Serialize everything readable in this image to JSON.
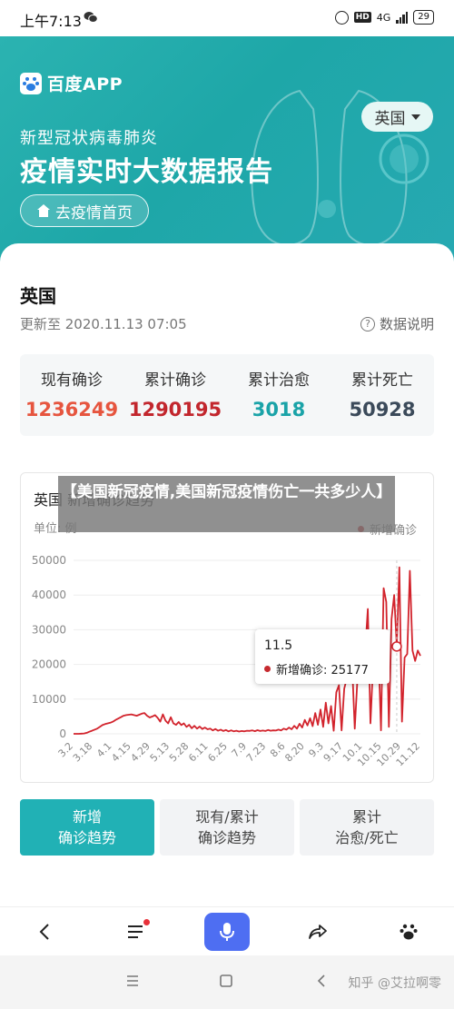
{
  "status_bar": {
    "time": "上午7:13",
    "network": "4G",
    "battery": "29"
  },
  "header": {
    "logo_text": "百度APP",
    "region": "英国",
    "subtitle": "新型冠状病毒肺炎",
    "title": "疫情实时大数据报告",
    "home_button": "去疫情首页"
  },
  "card": {
    "country": "英国",
    "update_time": "更新至 2020.11.13 07:05",
    "data_explain": "数据说明",
    "stats": [
      {
        "label": "现有确诊",
        "value": "1236249",
        "color": "#e6553f"
      },
      {
        "label": "累计确诊",
        "value": "1290195",
        "color": "#c2262d"
      },
      {
        "label": "累计治愈",
        "value": "3018",
        "color": "#1aa3a8"
      },
      {
        "label": "累计死亡",
        "value": "50928",
        "color": "#3b4a5a"
      }
    ]
  },
  "chart": {
    "title": "英国 新增确诊趋势",
    "unit": "单位: 例",
    "legend": "新增确诊",
    "tooltip_date": "11.5",
    "tooltip_label": "新增确诊: 25177"
  },
  "overlay_banner": "【美国新冠疫情,美国新冠疫情伤亡一共多少人】",
  "tabs": [
    {
      "line1": "新增",
      "line2": "确诊趋势"
    },
    {
      "line1": "现有/累计",
      "line2": "确诊趋势"
    },
    {
      "line1": "累计",
      "line2": "治愈/死亡"
    }
  ],
  "watermark": "知乎 @艾拉啊零",
  "colors": {
    "accent": "#21b1b5",
    "line": "#d2232c",
    "voice": "#4e6ef2"
  },
  "chart_data": {
    "type": "line",
    "title": "英国 新增确诊趋势",
    "xlabel": "",
    "ylabel": "单位: 例",
    "ylim": [
      0,
      50000
    ],
    "yticks": [
      0,
      10000,
      20000,
      30000,
      40000,
      50000
    ],
    "xtick_labels": [
      "3.2",
      "3.18",
      "4.1",
      "4.15",
      "4.29",
      "5.13",
      "5.28",
      "6.11",
      "6.25",
      "7.9",
      "7.23",
      "8.6",
      "8.20",
      "9.3",
      "9.17",
      "10.1",
      "10.15",
      "10.29",
      "11.12"
    ],
    "series": [
      {
        "name": "新增确诊",
        "color": "#d2232c",
        "values": [
          0,
          0,
          0,
          50,
          100,
          300,
          600,
          900,
          1200,
          1500,
          2000,
          2500,
          2800,
          3000,
          3200,
          3500,
          4000,
          4400,
          4800,
          5200,
          5400,
          5500,
          5600,
          5400,
          5200,
          5500,
          5800,
          6000,
          5200,
          4700,
          5000,
          5400,
          4600,
          3500,
          5600,
          3800,
          3000,
          4800,
          3000,
          2600,
          3400,
          2500,
          3000,
          2000,
          2600,
          1600,
          2300,
          1500,
          2100,
          1400,
          1800,
          1300,
          1500,
          1000,
          1400,
          900,
          1200,
          800,
          1100,
          700,
          1000,
          700,
          900,
          650,
          800,
          700,
          900,
          850,
          1000,
          750,
          1050,
          800,
          950,
          800,
          1100,
          900,
          1000,
          950,
          1200,
          1000,
          1500,
          1200,
          1800,
          1300,
          2300,
          1500,
          2900,
          1800,
          4000,
          2400,
          4500,
          2200,
          6000,
          2600,
          7000,
          2000,
          9000,
          3000,
          8000,
          900,
          12000,
          14000,
          1000,
          13000,
          16000,
          18000,
          20000,
          1500,
          15000,
          26000,
          19000,
          24000,
          36000,
          3000,
          20000,
          17000,
          25000,
          1000,
          42000,
          38000,
          2000,
          33000,
          40000,
          25177,
          48000,
          3500,
          22000,
          23000,
          47000,
          24000,
          21000,
          24000,
          22500
        ]
      }
    ]
  }
}
